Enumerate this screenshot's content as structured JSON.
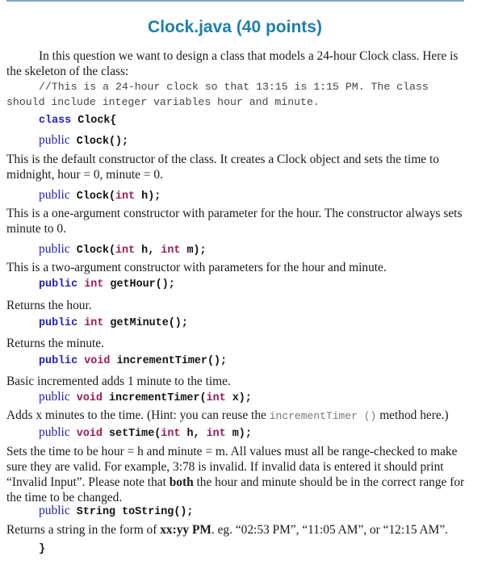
{
  "document": {
    "title": "Clock.java (40 points)",
    "intro_line1": "In this question we want to design a class that models a 24-hour Clock class. Here is",
    "intro_line2": "the skeleton of the class:",
    "comment_line1": "//This is a 24-hour clock so that 13:15 is 1:15 PM. The class",
    "comment_line2": "should include integer variables hour and minute.",
    "class_decl": {
      "keyword": "class",
      "name": "Clock{"
    },
    "members": [
      {
        "modifier": "public",
        "type": "",
        "signature": "Clock();",
        "description": [
          "This is the default constructor of the class. It creates a Clock object and sets the time to",
          "midnight, hour = 0, minute = 0."
        ]
      },
      {
        "modifier": "public",
        "type": "",
        "sig_prefix": "Clock(",
        "params": [
          {
            "type": "int",
            "name": "h"
          }
        ],
        "sig_suffix": ");",
        "description": [
          "This is a one-argument constructor with parameter for the hour. The constructor always sets",
          "minute to 0."
        ]
      },
      {
        "modifier": "public",
        "type": "",
        "sig_prefix": "Clock(",
        "params": [
          {
            "type": "int",
            "name": "h"
          },
          {
            "type": "int",
            "name": "m"
          }
        ],
        "sig_suffix": ");",
        "description": [
          "This is a two-argument constructor with parameters for the hour and minute."
        ]
      },
      {
        "modifier": "public",
        "type": "int",
        "signature": "getHour();",
        "description": [
          "Returns the hour."
        ]
      },
      {
        "modifier": "public",
        "type": "int",
        "signature": "getMinute();",
        "description": [
          "Returns the minute."
        ]
      },
      {
        "modifier": "public",
        "type": "void",
        "signature": "incrementTimer();",
        "description": [
          "Basic incremented adds 1 minute to the time."
        ]
      },
      {
        "modifier": "public",
        "type": "void",
        "sig_prefix": "incrementTimer(",
        "params": [
          {
            "type": "int",
            "name": "x"
          }
        ],
        "sig_suffix": ");",
        "description_prefix": "Adds x minutes to the time. (Hint: you can reuse the ",
        "description_code": "incrementTimer ()",
        "description_suffix": " method here.)"
      },
      {
        "modifier": "public",
        "type": "void",
        "sig_prefix": "setTime(",
        "params": [
          {
            "type": "int",
            "name": "h"
          },
          {
            "type": "int",
            "name": "m"
          }
        ],
        "sig_suffix": ");",
        "description": [
          "Sets the time to be hour = h and minute = m. All values must all be range-checked to make",
          "sure they are valid. For example, 3:78 is invalid. If invalid data is entered it should print"
        ],
        "description_line3_prefix": "“Invalid Input”. Please note that ",
        "description_line3_bold": "both",
        "description_line3_suffix": " the hour and minute should be in the correct range for",
        "description_line4": "the time to be changed."
      },
      {
        "modifier": "public",
        "type": "String",
        "signature": "toString();",
        "description_prefix": "Returns a string in the form of ",
        "description_bold": "xx:yy PM",
        "description_suffix": ". eg. “02:53 PM”, “11:05 AM”, or “12:15 AM”."
      }
    ],
    "closing_brace": "}"
  }
}
